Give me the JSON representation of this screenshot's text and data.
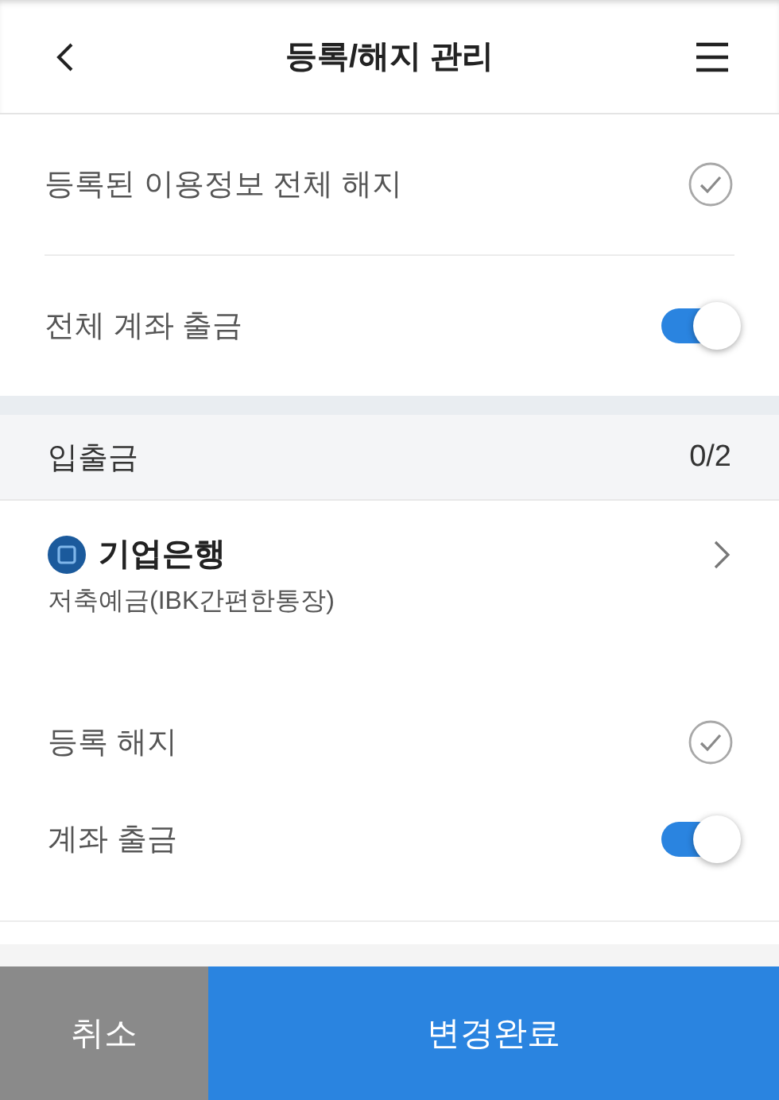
{
  "header": {
    "title": "등록/해지 관리"
  },
  "global_options": [
    {
      "kind": "check",
      "label": "등록된 이용정보 전체 해지",
      "checked": false
    },
    {
      "kind": "toggle",
      "label": "전체 계좌 출금",
      "on": true
    }
  ],
  "section": {
    "title": "입출금",
    "count": "0/2"
  },
  "accounts": [
    {
      "bank": "기업은행",
      "product": "저축예금(IBK간편한통장)",
      "options": [
        {
          "kind": "check",
          "label": "등록 해지",
          "checked": false
        },
        {
          "kind": "toggle",
          "label": "계좌 출금",
          "on": true
        }
      ]
    }
  ],
  "footer": {
    "cancel": "취소",
    "confirm": "변경완료"
  }
}
